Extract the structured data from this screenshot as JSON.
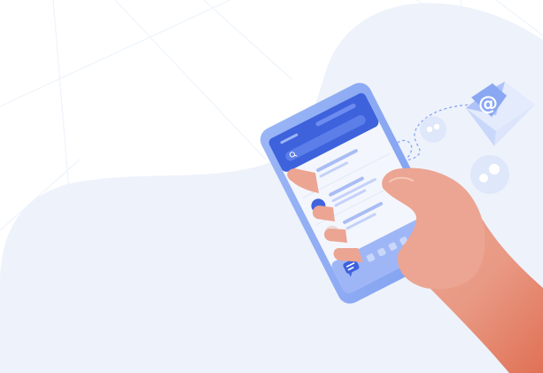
{
  "illustration": {
    "symbols": {
      "email_glyph": "@"
    },
    "icons": [
      "envelope-icon",
      "at-sign-icon",
      "chat-bubble-icon",
      "quote-bubble-icon",
      "search-icon",
      "home-button-icon"
    ],
    "colors": {
      "blob": "#eef2fb",
      "phone_frame": "#8aa8f2",
      "phone_screen": "#f4f6fd",
      "header_bar": "#3d62dc",
      "accent_blue": "#4a6cf0",
      "avatar_orange": "#d2694a",
      "avatar_blue": "#3f63df",
      "avatar_beige": "#eadbd7",
      "skin": "#eba592",
      "skin_dark": "#e07155",
      "envelope": "#c9d7fa",
      "envelope_dark": "#8aa8f2",
      "letter_yellow": "#f4c56a",
      "bubble": "#dfe7fb"
    }
  }
}
